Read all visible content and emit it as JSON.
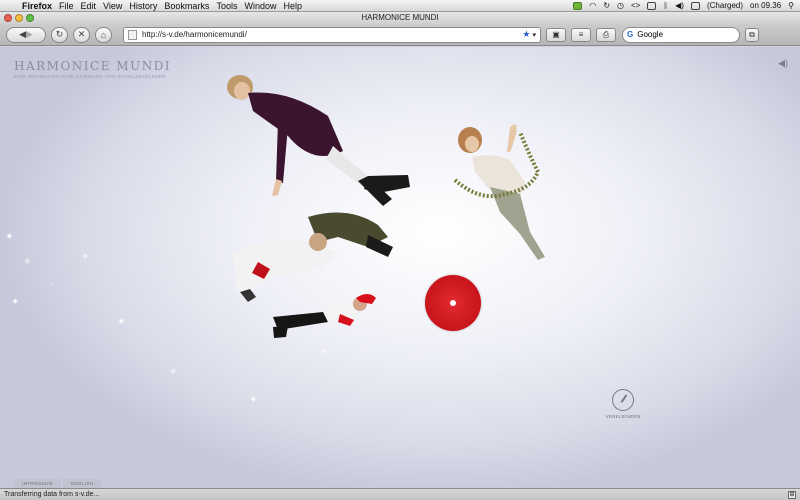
{
  "menubar": {
    "app_name": "Firefox",
    "items": [
      "File",
      "Edit",
      "View",
      "History",
      "Bookmarks",
      "Tools",
      "Window",
      "Help"
    ],
    "battery_status": "(Charged)",
    "clock": "on 09.36"
  },
  "window": {
    "title": "HARMONICE MUNDI"
  },
  "toolbar": {
    "url": "http://s-v.de/harmonicemundi/",
    "search_placeholder": "Google"
  },
  "page": {
    "brand_title": "HARMONICE MUNDI",
    "brand_subtitle": "EINE WEIHNACHTLICHE STIMMUNG VON SCHOLZ&VOLKNER",
    "zoom_label": "VERKLEINERN",
    "footer_links": [
      "IMPRESSUM",
      "ENGLISH"
    ]
  },
  "status": {
    "text": "Transferring data from s-v.de..."
  },
  "colors": {
    "accent_red": "#c8141b",
    "brand_gray": "#8b8c9c"
  }
}
